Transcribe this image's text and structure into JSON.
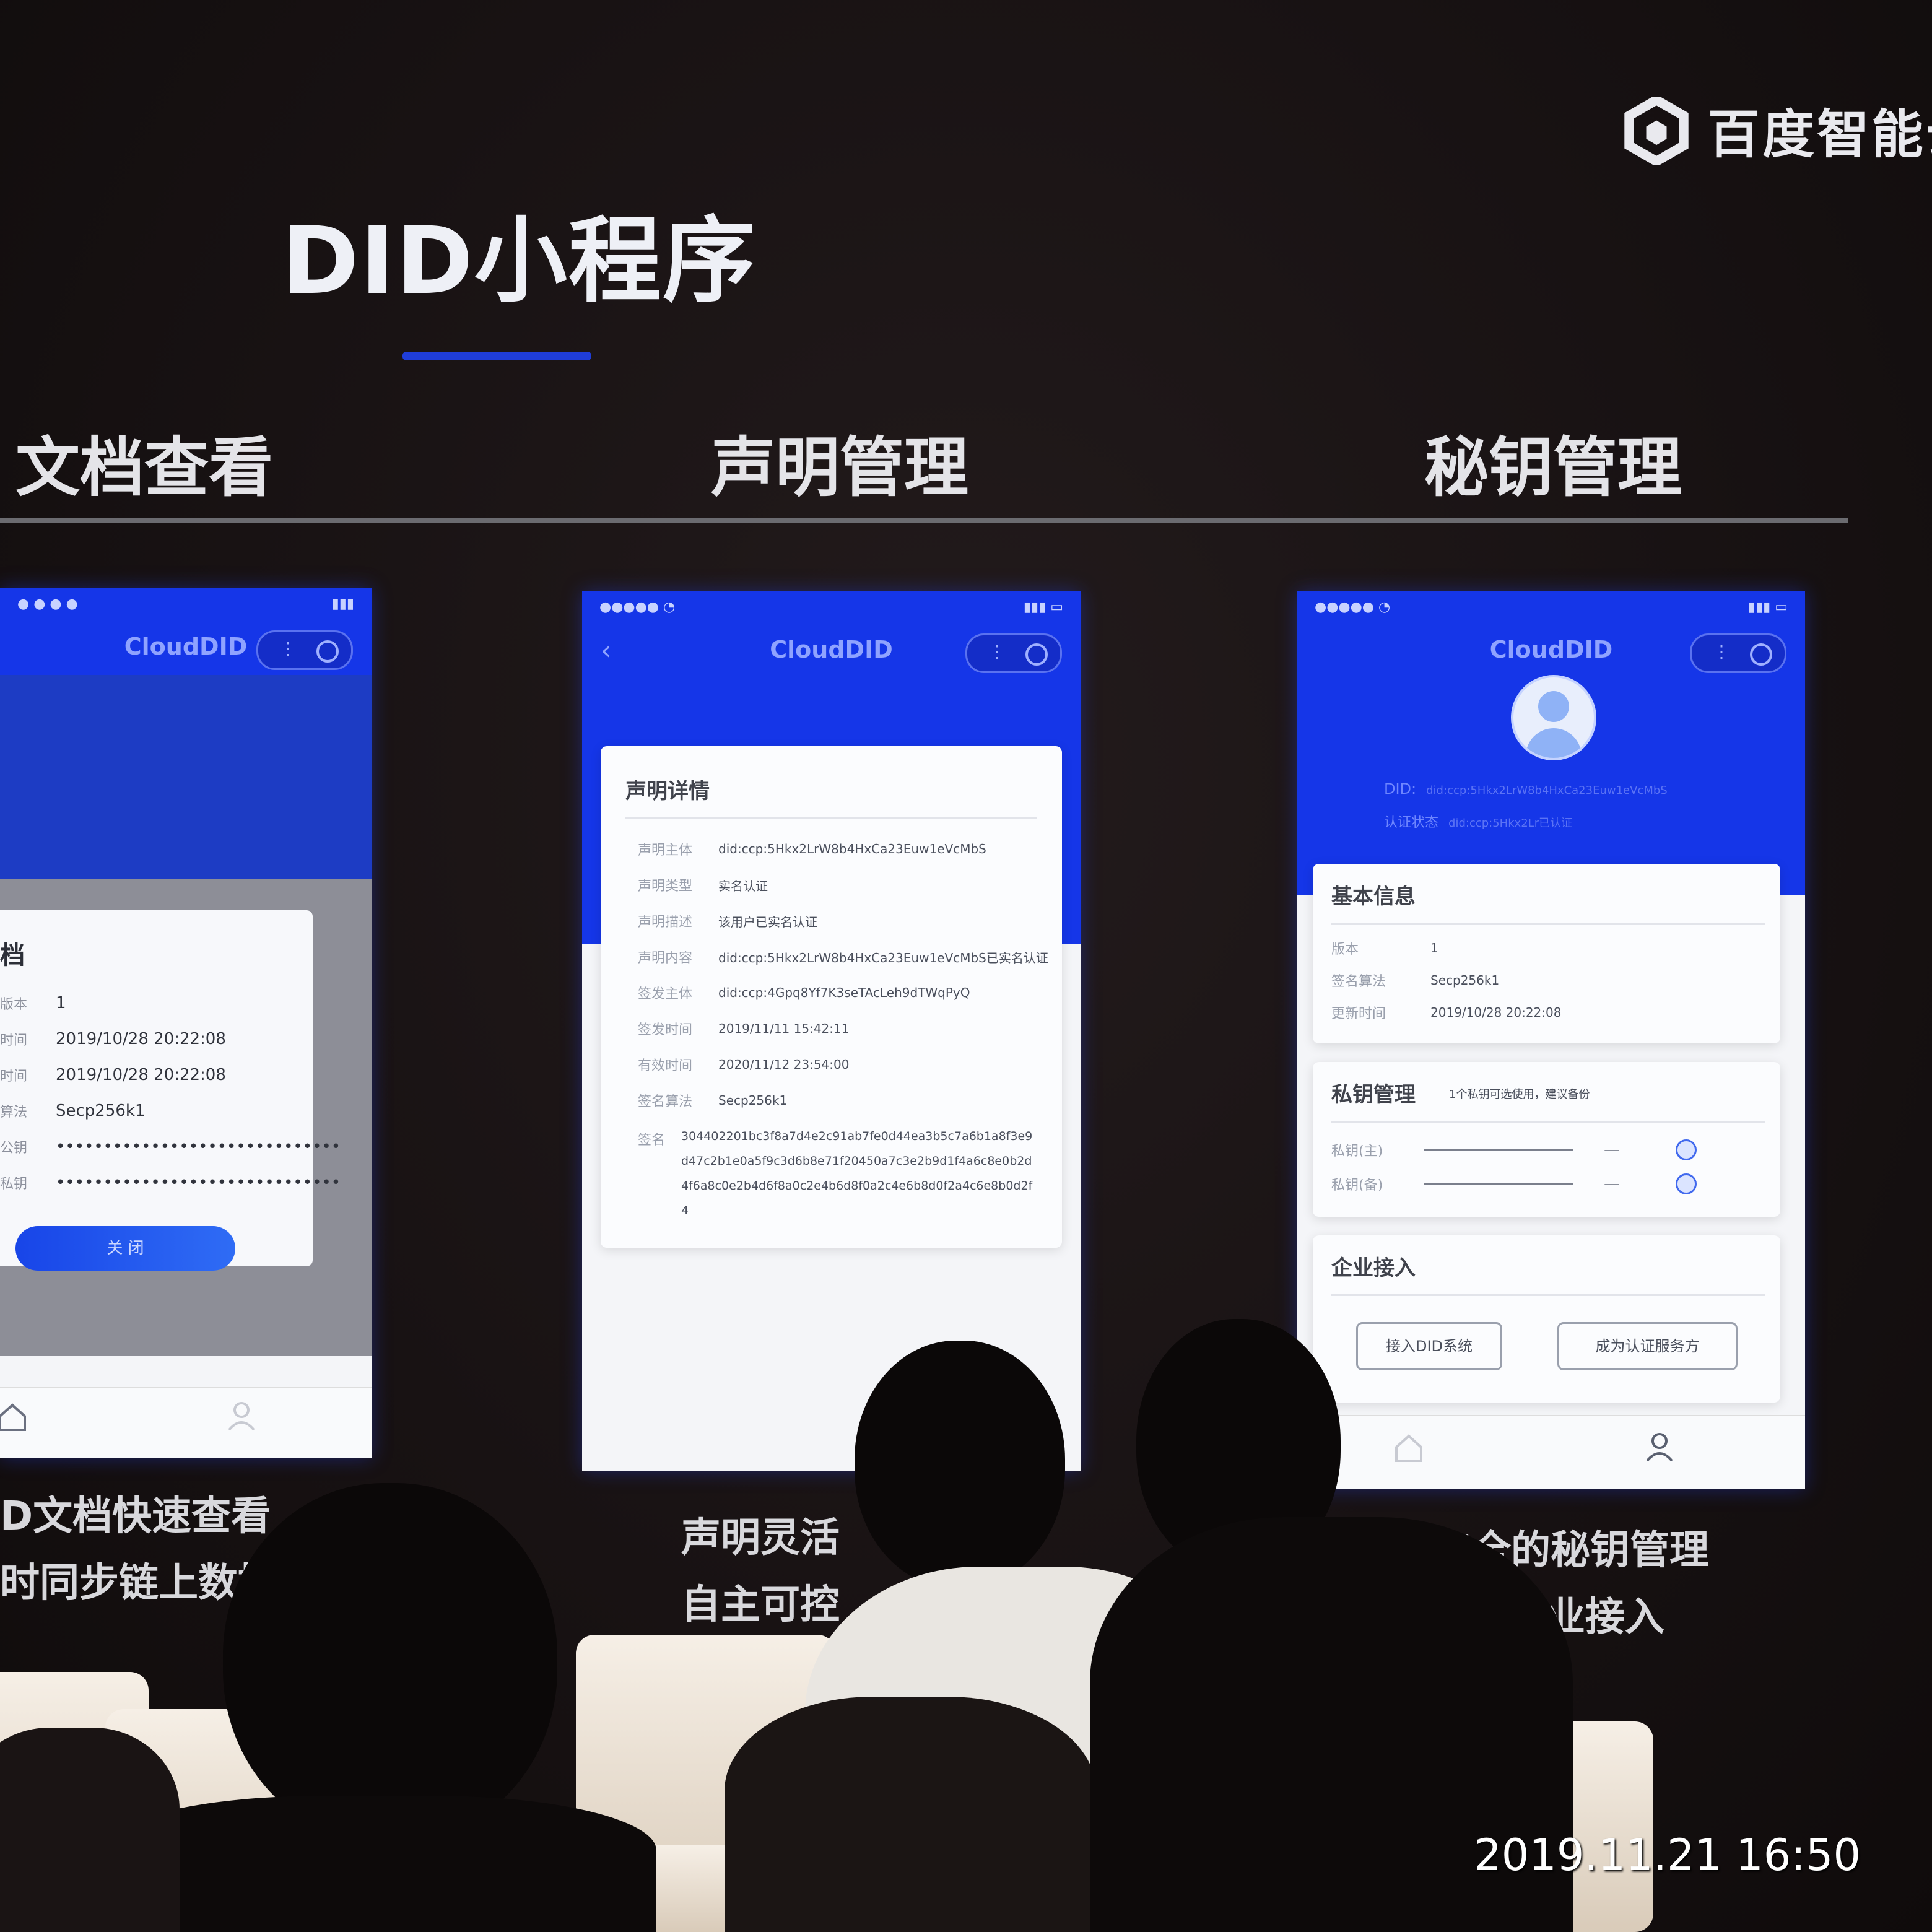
{
  "logo": {
    "text": "百度智能云",
    "icon": "baidu-cloud-hexagon-logo"
  },
  "slide_title": "DID小程序",
  "sections": [
    {
      "title": "文档查看",
      "caption_lines": [
        "D文档快速查看",
        "时同步链上数据"
      ]
    },
    {
      "title": "声明管理",
      "caption_lines": [
        "声明灵活",
        "自主可控"
      ]
    },
    {
      "title": "秘钥管理",
      "caption_lines": [
        "方便、安全的秘钥管理",
        "便捷的企业接入"
      ]
    }
  ],
  "phone1": {
    "app_title": "CloudDID",
    "dialog_title": "档",
    "rows": [
      {
        "label": "版本",
        "value": "1"
      },
      {
        "label": "时间",
        "value": "2019/10/28 20:22:08"
      },
      {
        "label": "时间",
        "value": "2019/10/28 20:22:08"
      },
      {
        "label": "算法",
        "value": "Secp256k1"
      },
      {
        "label": "公钥",
        "value": "••••••••••••••••••••••••••••••"
      },
      {
        "label": "私钥",
        "value": "••••••••••••••••••••••••••••••"
      }
    ],
    "button_label": "关 闭"
  },
  "phone2": {
    "app_title": "CloudDID",
    "card_title": "声明详情",
    "rows": [
      {
        "label": "声明主体",
        "value": "did:ccp:5Hkx2LrW8b4HxCa23Euw1eVcMbS"
      },
      {
        "label": "声明类型",
        "value": "实名认证"
      },
      {
        "label": "声明描述",
        "value": "该用户已实名认证"
      },
      {
        "label": "声明内容",
        "value": "did:ccp:5Hkx2LrW8b4HxCa23Euw1eVcMbS已实名认证"
      },
      {
        "label": "签发主体",
        "value": "did:ccp:4Gpq8Yf7K3seTAcLeh9dTWqPyQ"
      },
      {
        "label": "签发时间",
        "value": "2019/11/11 15:42:11"
      },
      {
        "label": "有效时间",
        "value": "2020/11/12 23:54:00"
      },
      {
        "label": "签名算法",
        "value": "Secp256k1"
      }
    ],
    "signature_label": "签名",
    "signature_value": "304402201bc3f8a7d4e2c91ab7fe0d44ea3b5c7a6b1a8f3e9d47c2b1e0a5f9c3d6b8e71f20450a7c3e2b9d1f4a6c8e0b2d4f6a8c0e2b4d6f8a0c2e4b6d8f0a2c4e6b8d0f2a4c6e8b0d2f4"
  },
  "phone3": {
    "app_title": "CloudDID",
    "did_label": "DID:",
    "did_value": "did:ccp:5Hkx2LrW8b4HxCa23Euw1eVcMbS",
    "sub_label": "认证状态",
    "sub_value": "did:ccp:5Hkx2Lr已认证",
    "basic_title": "基本信息",
    "basic_rows": [
      {
        "label": "版本",
        "value": "1"
      },
      {
        "label": "签名算法",
        "value": "Secp256k1"
      },
      {
        "label": "更新时间",
        "value": "2019/10/28 20:22:08"
      }
    ],
    "key_title": "私钥管理",
    "key_hint": "1个私钥可选使用，建议备份",
    "key_rows": [
      {
        "label": "私钥(主)",
        "dash": "—"
      },
      {
        "label": "私钥(备)",
        "dash": "—"
      }
    ],
    "enterprise_title": "企业接入",
    "btn_left": "接入DID系统",
    "btn_right": "成为认证服务方"
  },
  "timestamp": "2019.11.21 16:50"
}
